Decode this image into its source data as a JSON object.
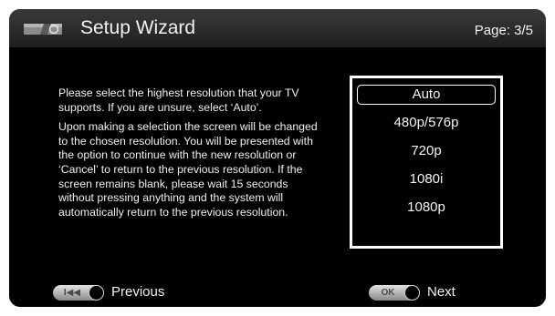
{
  "header": {
    "title": "Setup Wizard",
    "page_indicator": "Page: 3/5",
    "icon": "device-icon"
  },
  "instructions": {
    "paragraph1": "Please select the highest resolution that your TV supports. If you are unsure, select ‘Auto’.",
    "paragraph2": "Upon making a selection the screen will be changed to the chosen resolution. You will be presented with the option to continue with the new resolution or ‘Cancel’ to return to the previous resolution. If the screen remains blank, please wait 15 seconds without pressing anything and the system will automatically return to the previous resolution."
  },
  "options": {
    "items": [
      "Auto",
      "480p/576p",
      "720p",
      "1080i",
      "1080p"
    ],
    "selected": "Auto"
  },
  "footer": {
    "prev_button_glyph": "I◀◀",
    "prev_label": "Previous",
    "next_button_glyph": "OK",
    "next_label": "Next"
  }
}
